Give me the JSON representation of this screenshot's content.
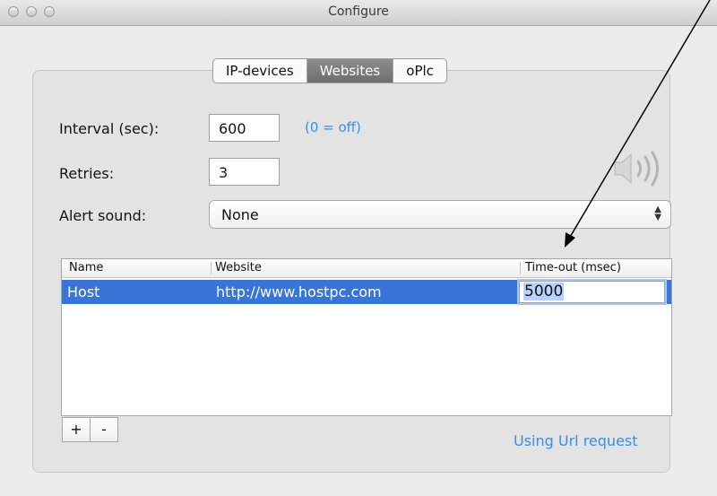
{
  "window": {
    "title": "Configure"
  },
  "tabs": [
    {
      "label": "IP-devices",
      "active": false
    },
    {
      "label": "Websites",
      "active": true
    },
    {
      "label": "oPlc",
      "active": false
    }
  ],
  "form": {
    "interval_label": "Interval (sec):",
    "interval_value": "600",
    "interval_hint": "(0 = off)",
    "retries_label": "Retries:",
    "retries_value": "3",
    "alert_label": "Alert sound:",
    "alert_value": "None"
  },
  "table": {
    "columns": [
      "Name",
      "Website",
      "Time-out (msec)"
    ],
    "rows": [
      {
        "name": "Host",
        "website": "http://www.hostpc.com",
        "timeout": "5000",
        "selected": true
      }
    ]
  },
  "buttons": {
    "add": "+",
    "remove": "-"
  },
  "status": {
    "link_text": "Using Url request"
  },
  "colors": {
    "accent": "#3a8ee6",
    "selection": "#3875d7"
  },
  "icons": [
    "speaker-icon",
    "arrow-annotation"
  ]
}
